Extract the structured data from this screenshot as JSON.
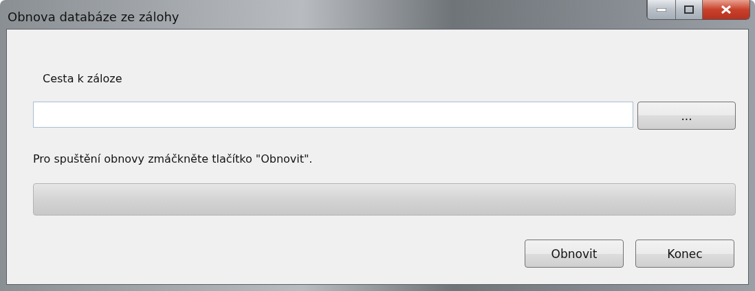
{
  "window": {
    "title": "Obnova databáze ze zálohy"
  },
  "path_label": "Cesta k záloze",
  "browse_button": "...",
  "status_text": "Pro spuštění obnovy zmáčkněte tlačítko \"Obnovit\".",
  "progress": {
    "level": 0
  },
  "buttons": [
    "Obnovit",
    "Konec"
  ]
}
